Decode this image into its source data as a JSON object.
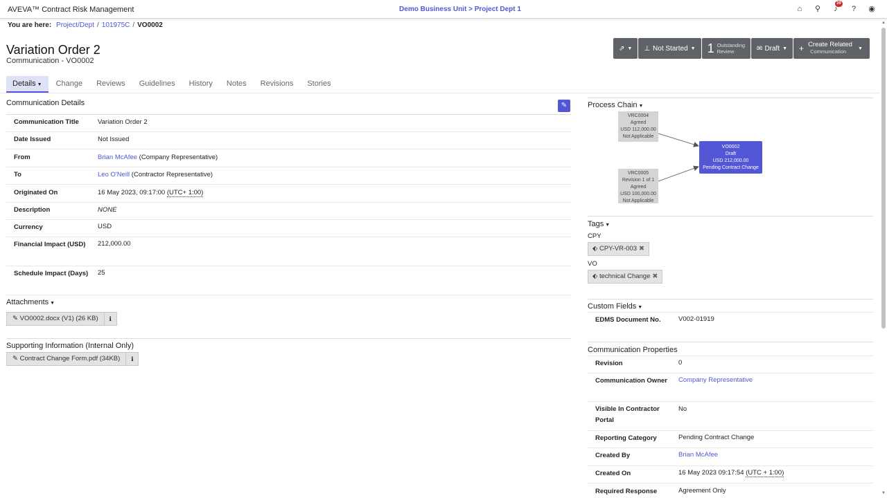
{
  "app": {
    "brand": "AVEVA™ Contract Risk Management",
    "business_unit": "Demo Business Unit",
    "project": "Project Dept 1",
    "crumb_sep": ">",
    "notification_count": "39"
  },
  "breadcrumb": {
    "label": "You are here:",
    "items": [
      "Project/Dept",
      "101975C"
    ],
    "current": "VO0002",
    "sep": "/"
  },
  "header": {
    "title": "Variation Order 2",
    "subtitle": "Communication - VO0002"
  },
  "actions": {
    "status": "Not Started",
    "outstanding_count": "1",
    "outstanding_l1": "Outstanding",
    "outstanding_l2": "Review",
    "draft": "Draft",
    "create_l1": "Create Related",
    "create_l2": "Communication"
  },
  "tabs": [
    "Details",
    "Change",
    "Reviews",
    "Guidelines",
    "History",
    "Notes",
    "Revisions",
    "Stories"
  ],
  "details": {
    "title": "Communication Details",
    "rows": [
      {
        "label": "Communication Title",
        "value": "Variation Order 2"
      },
      {
        "label": "Date Issued",
        "value": "Not Issued"
      },
      {
        "label": "From",
        "link": "Brian McAfee",
        "suffix": " (Company Representative)"
      },
      {
        "label": "To",
        "link": "Leo O'Neill",
        "suffix": " (Contractor Representative)"
      },
      {
        "label": "Originated On",
        "value": "16 May 2023, 09:17:00 ",
        "utc": "(UTC+ 1:00)"
      },
      {
        "label": "Description",
        "muted": "NONE"
      },
      {
        "label": "Currency",
        "value": "USD"
      },
      {
        "label": "Financial Impact (USD)",
        "value": "212,000.00"
      },
      {
        "label": "Schedule Impact (Days)",
        "value": "25"
      }
    ]
  },
  "attachments": {
    "title": "Attachments",
    "file": "VO0002.docx (V1) (26 KB)"
  },
  "supporting": {
    "title": "Supporting Information (Internal Only)",
    "file": "Contract Change Form.pdf (34KB)"
  },
  "process_chain": {
    "title": "Process Chain",
    "nodes": [
      {
        "lines": [
          "VRC0004",
          "Agreed",
          "USD 112,000.00",
          "Not Applicable"
        ]
      },
      {
        "lines": [
          "VRC0005",
          "Revision 1 of 1",
          "Agreed",
          "USD 100,000.00",
          "Not Applicable"
        ]
      },
      {
        "lines": [
          "VO0002",
          "Draft",
          "USD 212,000.00",
          "Pending Contract Change"
        ]
      }
    ]
  },
  "tags": {
    "title": "Tags",
    "groups": [
      {
        "name": "CPY",
        "tag": "CPY-VR-003"
      },
      {
        "name": "VO",
        "tag": "technical Change"
      }
    ]
  },
  "custom_fields": {
    "title": "Custom Fields",
    "rows": [
      {
        "label": "EDMS Document No.",
        "value": "V002-01919"
      }
    ]
  },
  "properties": {
    "title": "Communication Properties",
    "rows": [
      {
        "label": "Revision",
        "value": "0"
      },
      {
        "label": "Communication Owner",
        "link": "Company Representative"
      },
      {
        "label": "Visible In Contractor Portal",
        "value": "No"
      },
      {
        "label": "Reporting Category",
        "value": "Pending Contract Change"
      },
      {
        "label": "Created By",
        "link": "Brian McAfee"
      },
      {
        "label": "Created On",
        "value": "16 May 2023 09:17:54 ",
        "utc": "(UTC + 1:00)"
      },
      {
        "label": "Required Response",
        "value": "Agreement Only"
      }
    ]
  }
}
